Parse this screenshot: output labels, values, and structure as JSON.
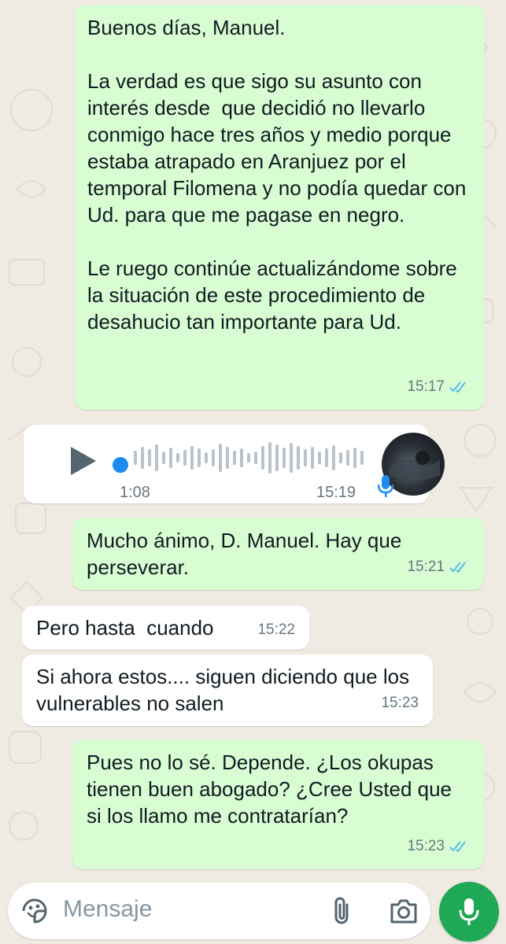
{
  "messages": [
    {
      "direction": "out",
      "text": "Buenos días, Manuel.\n\nLa verdad es que sigo su asunto con interés desde  que decidió no llevarlo conmigo hace tres años y medio porque estaba atrapado en Aranjuez por el temporal Filomena y no podía quedar con Ud. para que me pagase en negro.\n\nLe ruego continúe actualizándome sobre la situación de este procedimiento de desahucio tan importante para Ud.",
      "time": "15:17",
      "status": "read"
    },
    {
      "direction": "in",
      "type": "voice",
      "duration": "1:08",
      "time": "15:19",
      "progress": 0
    },
    {
      "direction": "out",
      "text": "Mucho ánimo, D. Manuel. Hay que perseverar.",
      "time": "15:21",
      "status": "read"
    },
    {
      "direction": "in",
      "text": "Pero hasta  cuando",
      "time": "15:22"
    },
    {
      "direction": "in",
      "text": "Si ahora estos.... siguen diciendo que los vulnerables no salen",
      "time": "15:23"
    },
    {
      "direction": "out",
      "text": "Pues no lo sé. Depende. ¿Los okupas tienen buen abogado? ¿Cree Usted que si los llamo me contratarían?",
      "time": "15:23",
      "status": "read"
    }
  ],
  "input": {
    "placeholder": "Mensaje"
  },
  "icons": {
    "emoji": "sticker-icon",
    "attach": "paperclip-icon",
    "camera": "camera-icon",
    "mic": "microphone-icon",
    "read_receipt": "double-check-icon",
    "play": "play-icon"
  },
  "colors": {
    "outgoing_bubble": "#d9fdd3",
    "incoming_bubble": "#ffffff",
    "background": "#efeae2",
    "read_tick": "#53bdeb",
    "mic_button": "#1fa855",
    "voice_progress": "#1c8cf2"
  }
}
